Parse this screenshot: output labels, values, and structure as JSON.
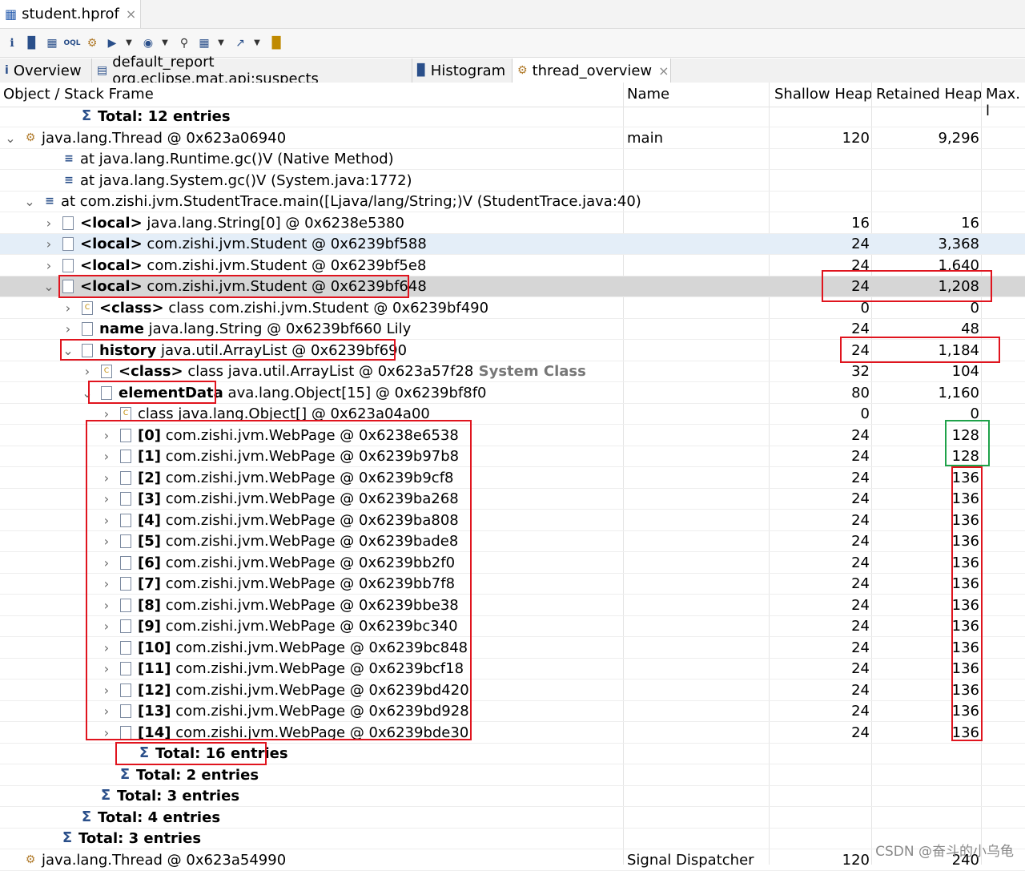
{
  "editor": {
    "title": "student.hprof",
    "icon": "database-icon",
    "close": "×"
  },
  "toolbar": {
    "icons": [
      "info-icon",
      "histogram-icon",
      "dominator-tree-icon",
      "oql-icon",
      "thread-overview-icon",
      "run-report-icon",
      "heap-dump-overview-icon",
      "search-icon",
      "calculator-icon",
      "export-icon",
      "pin-icon"
    ]
  },
  "view_tabs": [
    {
      "label": "Overview",
      "icon": "info-icon"
    },
    {
      "label": "default_report org.eclipse.mat.api:suspects",
      "icon": "report-icon"
    },
    {
      "label": "Histogram",
      "icon": "histogram-icon"
    },
    {
      "label": "thread_overview",
      "icon": "thread-icon",
      "close": "×"
    }
  ],
  "columns": {
    "object": "Object / Stack Frame",
    "name": "Name",
    "shallow": "Shallow Heap",
    "retained": "Retained Heap",
    "max": "Max. l"
  },
  "rows": [
    {
      "toggle": "",
      "icon": "sum",
      "bold": "Total: 12 entries",
      "text": "",
      "name": "",
      "shallow": "",
      "retained": ""
    },
    {
      "toggle": "v",
      "icon": "gear",
      "bold": "",
      "text": "java.lang.Thread @ 0x623a06940",
      "name": "main",
      "shallow": "120",
      "retained": "9,296"
    },
    {
      "toggle": "",
      "icon": "frame",
      "bold": "",
      "text": "at java.lang.Runtime.gc()V (Native Method)",
      "name": "",
      "shallow": "",
      "retained": ""
    },
    {
      "toggle": "",
      "icon": "frame",
      "bold": "",
      "text": "at java.lang.System.gc()V (System.java:1772)",
      "name": "",
      "shallow": "",
      "retained": ""
    },
    {
      "toggle": "v",
      "icon": "frame",
      "bold": "",
      "text": "at com.zishi.jvm.StudentTrace.main([Ljava/lang/String;)V (StudentTrace.java:40)",
      "name": "",
      "shallow": "",
      "retained": ""
    },
    {
      "toggle": ">",
      "icon": "doc",
      "bold": "<local>",
      "text": "java.lang.String[0] @ 0x6238e5380",
      "name": "",
      "shallow": "16",
      "retained": "16"
    },
    {
      "toggle": ">",
      "icon": "doc",
      "bold": "<local>",
      "text": "com.zishi.jvm.Student @ 0x6239bf588",
      "name": "",
      "shallow": "24",
      "retained": "3,368"
    },
    {
      "toggle": ">",
      "icon": "doc",
      "bold": "<local>",
      "text": "com.zishi.jvm.Student @ 0x6239bf5e8",
      "name": "",
      "shallow": "24",
      "retained": "1,640"
    },
    {
      "toggle": "v",
      "icon": "doc",
      "bold": "<local>",
      "text": "com.zishi.jvm.Student @ 0x6239bf648",
      "name": "",
      "shallow": "24",
      "retained": "1,208"
    },
    {
      "toggle": ">",
      "icon": "class",
      "bold": "<class>",
      "text": "class com.zishi.jvm.Student @ 0x6239bf490",
      "name": "",
      "shallow": "0",
      "retained": "0"
    },
    {
      "toggle": ">",
      "icon": "doc",
      "bold": "name",
      "text": "java.lang.String @ 0x6239bf660  Lily",
      "name": "",
      "shallow": "24",
      "retained": "48"
    },
    {
      "toggle": "v",
      "icon": "doc",
      "bold": "history",
      "text": "java.util.ArrayList @ 0x6239bf690",
      "name": "",
      "shallow": "24",
      "retained": "1,184"
    },
    {
      "toggle": ">",
      "icon": "class",
      "bold": "<class>",
      "text": "class java.util.ArrayList @ 0x623a57f28",
      "extra": "System Class",
      "name": "",
      "shallow": "32",
      "retained": "104"
    },
    {
      "toggle": "v",
      "icon": "doc",
      "bold": "elementData",
      "text": "ava.lang.Object[15] @ 0x6239bf8f0",
      "name": "",
      "shallow": "80",
      "retained": "1,160"
    },
    {
      "toggle": ">",
      "icon": "class",
      "bold": "",
      "text": "class java.lang.Object[] @ 0x623a04a00",
      "name": "",
      "shallow": "0",
      "retained": "0"
    },
    {
      "toggle": ">",
      "icon": "doc",
      "bold": "[0]",
      "text": "com.zishi.jvm.WebPage @ 0x6238e6538",
      "name": "",
      "shallow": "24",
      "retained": "128"
    },
    {
      "toggle": ">",
      "icon": "doc",
      "bold": "[1]",
      "text": "com.zishi.jvm.WebPage @ 0x6239b97b8",
      "name": "",
      "shallow": "24",
      "retained": "128"
    },
    {
      "toggle": ">",
      "icon": "doc",
      "bold": "[2]",
      "text": "com.zishi.jvm.WebPage @ 0x6239b9cf8",
      "name": "",
      "shallow": "24",
      "retained": "136"
    },
    {
      "toggle": ">",
      "icon": "doc",
      "bold": "[3]",
      "text": "com.zishi.jvm.WebPage @ 0x6239ba268",
      "name": "",
      "shallow": "24",
      "retained": "136"
    },
    {
      "toggle": ">",
      "icon": "doc",
      "bold": "[4]",
      "text": "com.zishi.jvm.WebPage @ 0x6239ba808",
      "name": "",
      "shallow": "24",
      "retained": "136"
    },
    {
      "toggle": ">",
      "icon": "doc",
      "bold": "[5]",
      "text": "com.zishi.jvm.WebPage @ 0x6239bade8",
      "name": "",
      "shallow": "24",
      "retained": "136"
    },
    {
      "toggle": ">",
      "icon": "doc",
      "bold": "[6]",
      "text": "com.zishi.jvm.WebPage @ 0x6239bb2f0",
      "name": "",
      "shallow": "24",
      "retained": "136"
    },
    {
      "toggle": ">",
      "icon": "doc",
      "bold": "[7]",
      "text": "com.zishi.jvm.WebPage @ 0x6239bb7f8",
      "name": "",
      "shallow": "24",
      "retained": "136"
    },
    {
      "toggle": ">",
      "icon": "doc",
      "bold": "[8]",
      "text": "com.zishi.jvm.WebPage @ 0x6239bbe38",
      "name": "",
      "shallow": "24",
      "retained": "136"
    },
    {
      "toggle": ">",
      "icon": "doc",
      "bold": "[9]",
      "text": "com.zishi.jvm.WebPage @ 0x6239bc340",
      "name": "",
      "shallow": "24",
      "retained": "136"
    },
    {
      "toggle": ">",
      "icon": "doc",
      "bold": "[10]",
      "text": "com.zishi.jvm.WebPage @ 0x6239bc848",
      "name": "",
      "shallow": "24",
      "retained": "136"
    },
    {
      "toggle": ">",
      "icon": "doc",
      "bold": "[11]",
      "text": "com.zishi.jvm.WebPage @ 0x6239bcf18",
      "name": "",
      "shallow": "24",
      "retained": "136"
    },
    {
      "toggle": ">",
      "icon": "doc",
      "bold": "[12]",
      "text": "com.zishi.jvm.WebPage @ 0x6239bd420",
      "name": "",
      "shallow": "24",
      "retained": "136"
    },
    {
      "toggle": ">",
      "icon": "doc",
      "bold": "[13]",
      "text": "com.zishi.jvm.WebPage @ 0x6239bd928",
      "name": "",
      "shallow": "24",
      "retained": "136"
    },
    {
      "toggle": ">",
      "icon": "doc",
      "bold": "[14]",
      "text": "com.zishi.jvm.WebPage @ 0x6239bde30",
      "name": "",
      "shallow": "24",
      "retained": "136"
    },
    {
      "toggle": "",
      "icon": "sum",
      "bold": "Total: 16 entries",
      "text": "",
      "name": "",
      "shallow": "",
      "retained": ""
    },
    {
      "toggle": "",
      "icon": "sum",
      "bold": "Total: 2 entries",
      "text": "",
      "name": "",
      "shallow": "",
      "retained": ""
    },
    {
      "toggle": "",
      "icon": "sum",
      "bold": "Total: 3 entries",
      "text": "",
      "name": "",
      "shallow": "",
      "retained": ""
    },
    {
      "toggle": "",
      "icon": "sum",
      "bold": "Total: 4 entries",
      "text": "",
      "name": "",
      "shallow": "",
      "retained": ""
    },
    {
      "toggle": "",
      "icon": "sum",
      "bold": "Total: 3 entries",
      "text": "",
      "name": "",
      "shallow": "",
      "retained": ""
    },
    {
      "toggle": "",
      "icon": "gear",
      "bold": "",
      "text": "java.lang.Thread @ 0x623a54990",
      "name": "Signal Dispatcher",
      "shallow": "120",
      "retained": "240"
    }
  ],
  "annotation_colors": {
    "highlight": "#e0141e",
    "green": "#1fa24a"
  },
  "watermark": "CSDN @奋斗的小乌龟"
}
